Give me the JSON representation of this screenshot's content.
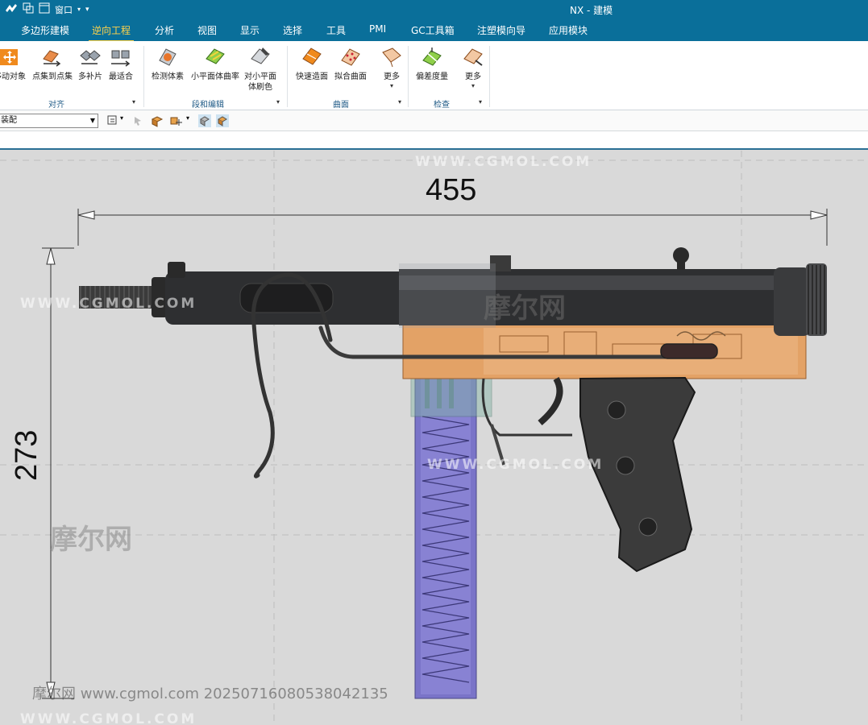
{
  "window": {
    "title": "NX - 建模",
    "menu_window": "窗口"
  },
  "tabs": [
    {
      "label": "多边形建模",
      "active": false
    },
    {
      "label": "逆向工程",
      "active": true
    },
    {
      "label": "分析",
      "active": false
    },
    {
      "label": "视图",
      "active": false
    },
    {
      "label": "显示",
      "active": false
    },
    {
      "label": "选择",
      "active": false
    },
    {
      "label": "工具",
      "active": false
    },
    {
      "label": "PMI",
      "active": false
    },
    {
      "label": "GC工具箱",
      "active": false
    },
    {
      "label": "注塑模向导",
      "active": false
    },
    {
      "label": "应用模块",
      "active": false
    }
  ],
  "ribbon": {
    "buttons": {
      "move_object": "移动对象",
      "points_to_points": "点集到点集",
      "multi_patch": "多补片",
      "best_fit": "最适合",
      "inspect_body": "检测体素",
      "facet_curvature": "小平面体曲率",
      "facet_color": "对小平面",
      "facet_color_2": "体刷色",
      "rapid_surface": "快速造面",
      "fit_surface": "拟合曲面",
      "more_1": "更多",
      "deviation": "偏差度量",
      "more_2": "更多"
    },
    "groups": {
      "align": "对齐",
      "facet_edit": "段和编辑",
      "surface": "曲面",
      "inspect": "检查"
    }
  },
  "selection_bar": {
    "filter_value": "装配"
  },
  "viewport": {
    "dimension_width": "455",
    "dimension_height": "273",
    "watermark_url": "WWW.CGMOL.COM",
    "watermark_cn": "摩尔网",
    "footnote": "摩尔网 www.cgmol.com 20250716080538042135"
  },
  "colors": {
    "titlebar": "#0a6f9a",
    "active_tab": "#ffd24a",
    "viewport_bg": "#d9d9d9",
    "barrel": "#2e2f31",
    "receiver": "#e3a266",
    "magazine": "#7a74c8",
    "grip": "#3b3b3b"
  }
}
